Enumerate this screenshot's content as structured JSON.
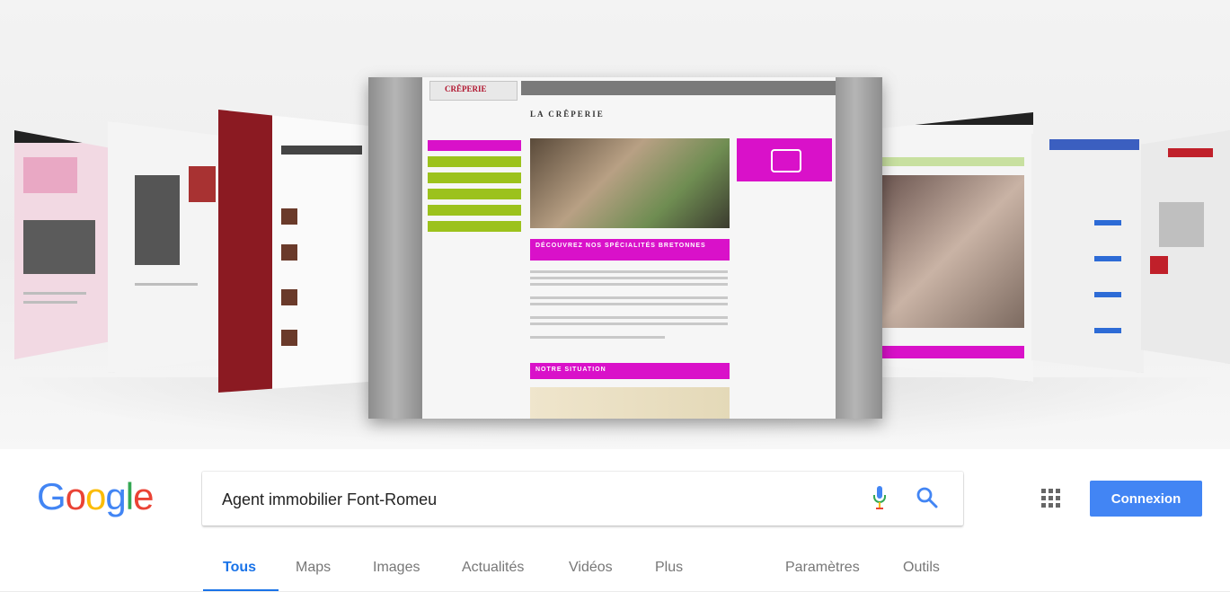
{
  "search": {
    "query": "Agent immobilier Font-Romeu",
    "logo_letters": [
      "G",
      "o",
      "o",
      "g",
      "l",
      "e"
    ],
    "logo_colors": [
      "#4285f4",
      "#ea4335",
      "#fbbc05",
      "#4285f4",
      "#34a853",
      "#ea4335"
    ],
    "mic_icon": "microphone-icon",
    "search_icon": "magnifier-icon"
  },
  "header": {
    "apps_icon": "apps-grid-icon",
    "signin_label": "Connexion",
    "signin_color": "#4285f4"
  },
  "tabs": {
    "items": [
      "Tous",
      "Maps",
      "Images",
      "Actualités",
      "Vidéos",
      "Plus"
    ],
    "active": "Tous",
    "right": [
      "Paramètres",
      "Outils"
    ],
    "accent": "#1a73e8"
  },
  "hero": {
    "featured_site": {
      "logo_text": "CRÊPERIE",
      "title": "LA CRÊPERIE",
      "section_heading_1": "DÉCOUVREZ NOS SPÉCIALITÉS BRETONNES",
      "section_heading_2": "NOTRE SITUATION",
      "accent_pink": "#d911c9",
      "accent_green": "#9cc21c"
    }
  }
}
